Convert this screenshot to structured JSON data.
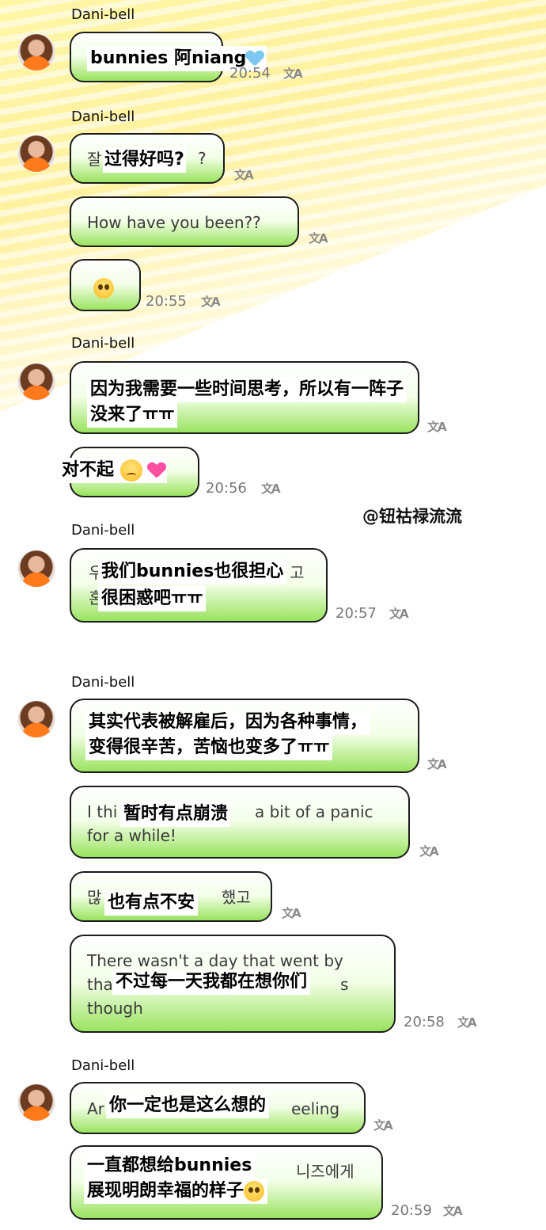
{
  "sender_name": "Dani-bell",
  "watermark": "@钮祜禄流流",
  "messages": [
    {
      "id": "m1",
      "text_under": "",
      "overlay": "bunnies 阿niang",
      "time": "20:54"
    },
    {
      "id": "m2",
      "text_under": "잘",
      "overlay": "过得好吗?",
      "trail": "?"
    },
    {
      "id": "m3",
      "text_under": "How have you been??"
    },
    {
      "id": "m4",
      "time": "20:55"
    },
    {
      "id": "m5",
      "overlay_line1": "因为我需要一些时间思考，所以有一阵子",
      "overlay_line2": "没来了ㅠㅠ"
    },
    {
      "id": "m6",
      "overlay": "对不起",
      "time": "20:56"
    },
    {
      "id": "m7",
      "under_line1": "우",
      "under_line1_end": "고",
      "under_line2": "혼",
      "overlay_line1": "我们bunnies也很担心",
      "overlay_line2": "很困惑吧ㅠㅠ",
      "time": "20:57"
    },
    {
      "id": "m8",
      "overlay_line1": "其实代表被解雇后，因为各种事情，",
      "overlay_line2": "变得很辛苦，苦恼也变多了ㅠㅠ"
    },
    {
      "id": "m9",
      "under_line1a": "I thi",
      "under_line1b": "a bit of a panic",
      "under_line2": "for a while!",
      "overlay": "暂时有点崩溃"
    },
    {
      "id": "m10",
      "under_start": "많",
      "under_end": "했고",
      "overlay": "也有点不安"
    },
    {
      "id": "m11",
      "under_line1": "There wasn't a day that went by",
      "under_line2a": "tha",
      "under_line2b": "s",
      "under_line3": "though",
      "overlay": "不过每一天我都在想你们",
      "time": "20:58"
    },
    {
      "id": "m12",
      "under_start": "Ar",
      "under_end": "eeling",
      "overlay": "你一定也是这么想的"
    },
    {
      "id": "m13",
      "under_end": "니즈에게",
      "overlay_line1": "一直都想给bunnies",
      "overlay_line2": "展现明朗幸福的样子",
      "time": "20:59"
    }
  ],
  "translate_icon": "文A",
  "icons": [
    "avatar",
    "translate-icon",
    "emoji-pleading-face",
    "emoji-pensive-face",
    "emoji-blue-heart",
    "emoji-sparkling-heart"
  ]
}
